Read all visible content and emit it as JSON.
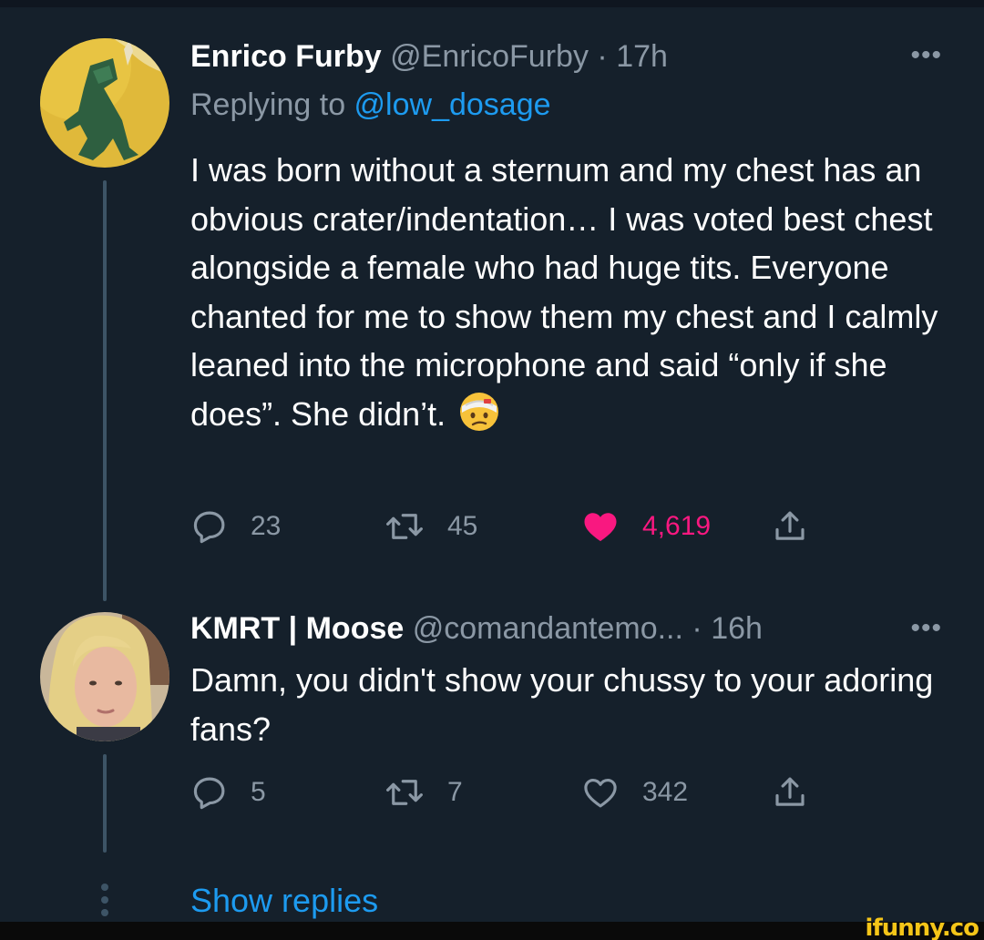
{
  "tweet1": {
    "name": "Enrico Furby",
    "handle": "@EnricoFurby",
    "separator": "·",
    "time": "17h",
    "more_icon": "•••",
    "replying_prefix": "Replying to ",
    "replying_handle": "@low_dosage",
    "text": "I was born without a sternum and my chest has an obvious crater/indentation… I was voted best chest alongside a female who had huge tits. Everyone chanted for me to show them my chest and I calmly leaned into the microphone and said “only if she does”. She didn’t.",
    "emoji": "face-with-head-bandage-icon",
    "replies": "23",
    "retweets": "45",
    "likes": "4,619",
    "liked": true
  },
  "tweet2": {
    "name": "KMRT | Moose",
    "handle": "@comandantemo...",
    "separator": "·",
    "time": "16h",
    "more_icon": "•••",
    "text": "Damn, you didn't show your chussy to your adoring fans?",
    "replies": "5",
    "retweets": "7",
    "likes": "342",
    "liked": false
  },
  "show_replies": "Show replies",
  "watermark": "ifunny.co",
  "colors": {
    "background": "#15202b",
    "link": "#1d9bf0",
    "muted": "#8b98a5",
    "like": "#f91880"
  }
}
